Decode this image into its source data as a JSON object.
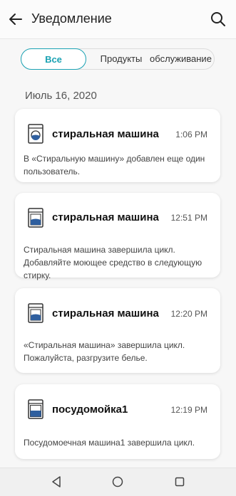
{
  "header": {
    "title": "Уведомление"
  },
  "tabs": [
    {
      "label": "Все"
    },
    {
      "label": "Продукты"
    },
    {
      "label": "обслуживание"
    }
  ],
  "date_label": "Июль 16, 2020",
  "notifications": [
    {
      "device": "стиральная машина",
      "time": "1:06 PM",
      "message": "В «Стиральную машину» добавлен еще один пользователь.",
      "icon": "washer-icon"
    },
    {
      "device": "стиральная машина",
      "time": "12:51 PM",
      "message": "Стиральная машина завершила цикл. Добавляйте моющее средство в следующую стирку.",
      "icon": "washer-icon"
    },
    {
      "device": "стиральная машина",
      "time": "12:20 PM",
      "message": "«Стиральная машина» завершила цикл. Пожалуйста, разгрузите белье.",
      "icon": "washer-icon"
    },
    {
      "device": "посудомойка1",
      "time": "12:19 PM",
      "message": "Посудомоечная машина1 завершила цикл.",
      "icon": "dishwasher-icon"
    }
  ],
  "colors": {
    "accent": "#1aa2b3",
    "icon_blue": "#2f5f9f"
  },
  "nav_icons": [
    "back-triangle-icon",
    "home-circle-icon",
    "recents-square-icon"
  ]
}
